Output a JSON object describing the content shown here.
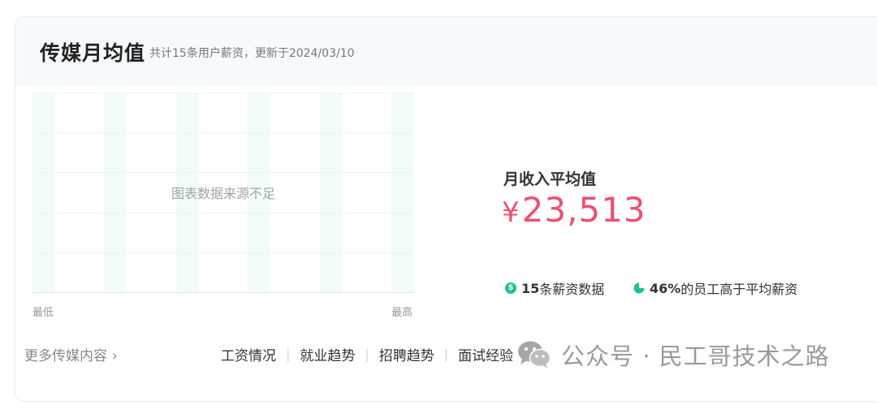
{
  "header": {
    "title": "传媒月均值",
    "subtitle": "共计15条用户薪资，更新于2024/03/10"
  },
  "chart": {
    "empty_message": "图表数据来源不足",
    "axis_min_label": "最低",
    "axis_max_label": "最高"
  },
  "stats": {
    "average_label": "月收入平均值",
    "currency": "¥",
    "average_value": "23,513",
    "records_count": "15",
    "records_label": "条薪资数据",
    "dollar_icon_glyph": "$",
    "above_avg_percent": "46%",
    "above_avg_label": "的员工高于平均薪资"
  },
  "footer": {
    "more_link": "更多传媒内容",
    "links": [
      "工资情况",
      "就业趋势",
      "招聘趋势",
      "面试经验"
    ],
    "separator": "|"
  },
  "watermark": {
    "text": "公众号 · 民工哥技术之路"
  },
  "colors": {
    "accent_red": "#ef4f72",
    "icon_green": "#1bc298",
    "header_bg": "#f7f9fc",
    "chart_stripe": "#f3fbf8"
  },
  "icons": {
    "more_chevron": "chevron-right-icon",
    "records": "dollar-icon",
    "percent": "pie-chart-icon",
    "watermark": "wechat-icon"
  }
}
